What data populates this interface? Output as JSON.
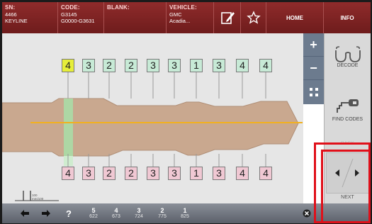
{
  "topbar": {
    "sn": {
      "label": "SN:",
      "line1": "4466",
      "line2": "KEYLINE"
    },
    "code": {
      "label": "CODE:",
      "line1": "G3145",
      "line2": "G0000-G3631"
    },
    "blank": {
      "label": "BLANK:"
    },
    "vehicle": {
      "label": "VEHICLE:",
      "line1": "GMC",
      "line2": "Acadia..."
    },
    "home_label": "HOME",
    "info_label": "INFO"
  },
  "cuts": {
    "top": [
      "4",
      "3",
      "2",
      "2",
      "3",
      "3",
      "1",
      "3",
      "4",
      "4"
    ],
    "bottom": [
      "4",
      "3",
      "2",
      "2",
      "3",
      "3",
      "1",
      "3",
      "4",
      "4"
    ],
    "selected_index": 0
  },
  "zoom": {
    "plus": "+",
    "minus": "−"
  },
  "rightmenu": {
    "decode_label": "DECODE",
    "find_codes_label": "FIND CODES",
    "back_label": "BACK",
    "next_label": "NEXT"
  },
  "scale": {
    "line1": "100",
    "line2": "mm/100"
  },
  "bottombar": {
    "question": "?",
    "depths": [
      {
        "num": "5",
        "val": "622"
      },
      {
        "num": "4",
        "val": "673"
      },
      {
        "num": "3",
        "val": "724"
      },
      {
        "num": "2",
        "val": "775"
      },
      {
        "num": "1",
        "val": "825"
      }
    ]
  },
  "colors": {
    "topbar": "#7d2424",
    "key": "#c9a88f",
    "shoulder": "#a8dfa8",
    "centerline": "#f2b01e",
    "cut_line": "#e8737a",
    "highlight": "#e0101a"
  }
}
